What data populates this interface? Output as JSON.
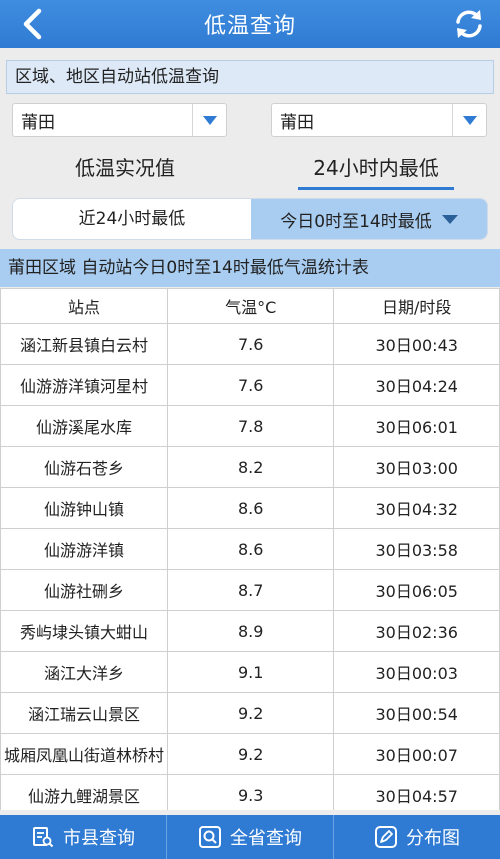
{
  "header": {
    "title": "低温查询"
  },
  "section_title": "区域、地区自动站低温查询",
  "selects": {
    "region": "莆田",
    "area": "莆田"
  },
  "tabs": {
    "live": "低温实况值",
    "min24": "24小时内最低"
  },
  "segments": {
    "last24": "近24小时最低",
    "today": "今日0时至14时最低"
  },
  "caption": "莆田区域 自动站今日0时至14时最低气温统计表",
  "table": {
    "columns": [
      "站点",
      "气温°C",
      "日期/时段"
    ],
    "rows": [
      [
        "涵江新县镇白云村",
        "7.6",
        "30日00:43"
      ],
      [
        "仙游游洋镇河星村",
        "7.6",
        "30日04:24"
      ],
      [
        "仙游溪尾水库",
        "7.8",
        "30日06:01"
      ],
      [
        "仙游石苍乡",
        "8.2",
        "30日03:00"
      ],
      [
        "仙游钟山镇",
        "8.6",
        "30日04:32"
      ],
      [
        "仙游游洋镇",
        "8.6",
        "30日03:58"
      ],
      [
        "仙游社硎乡",
        "8.7",
        "30日06:05"
      ],
      [
        "秀屿埭头镇大蚶山",
        "8.9",
        "30日02:36"
      ],
      [
        "涵江大洋乡",
        "9.1",
        "30日00:03"
      ],
      [
        "涵江瑞云山景区",
        "9.2",
        "30日00:54"
      ],
      [
        "城厢凤凰山街道林桥村",
        "9.2",
        "30日00:07"
      ],
      [
        "仙游九鲤湖景区",
        "9.3",
        "30日04:57"
      ]
    ]
  },
  "bottom_nav": {
    "county": "市县查询",
    "province": "全省查询",
    "map": "分布图"
  }
}
